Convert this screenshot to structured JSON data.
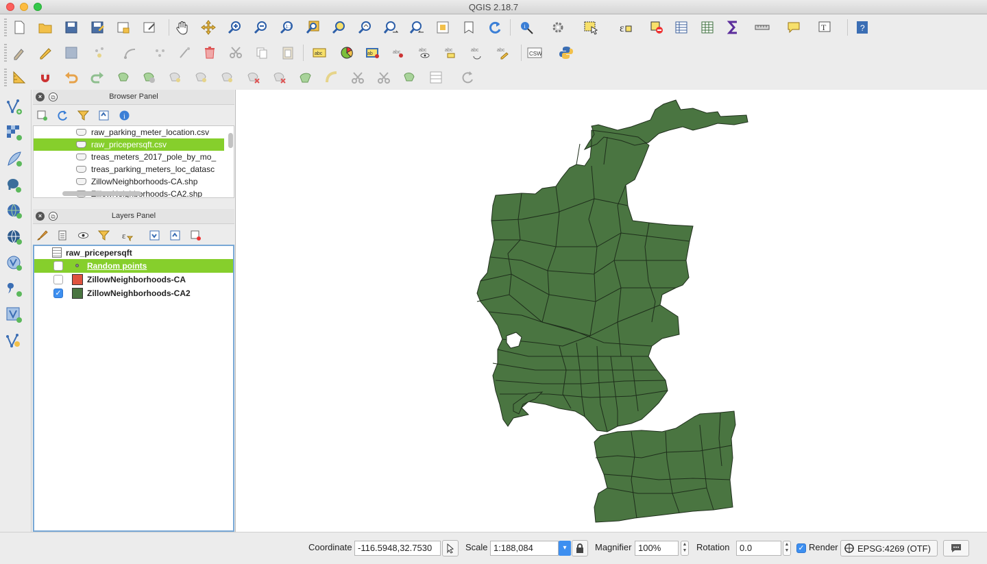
{
  "window": {
    "title": "QGIS 2.18.7"
  },
  "browser_panel": {
    "title": "Browser Panel",
    "items": [
      {
        "label": "raw_parking_meter_location.csv"
      },
      {
        "label": "raw_pricepersqft.csv",
        "selected": true
      },
      {
        "label": "treas_meters_2017_pole_by_mo_"
      },
      {
        "label": "treas_parking_meters_loc_datasc"
      },
      {
        "label": "ZillowNeighborhoods-CA.shp"
      },
      {
        "label": "ZillowNeighborhoods-CA2.shp"
      }
    ]
  },
  "layers_panel": {
    "title": "Layers Panel",
    "layers": [
      {
        "label": "raw_pricepersqft",
        "type": "table"
      },
      {
        "label": "Random points",
        "checked": false,
        "selected": true
      },
      {
        "label": "ZillowNeighborhoods-CA",
        "checked": false,
        "color": "#e0533f"
      },
      {
        "label": "ZillowNeighborhoods-CA2",
        "checked": true,
        "color": "#4a7541"
      }
    ]
  },
  "map": {
    "fill_color": "#4a7541",
    "stroke_color": "#1e2e1b"
  },
  "statusbar": {
    "coordinate_label": "Coordinate",
    "coordinate_value": "-116.5948,32.7530",
    "scale_label": "Scale",
    "scale_value": "1:188,084",
    "magnifier_label": "Magnifier",
    "magnifier_value": "100%",
    "rotation_label": "Rotation",
    "rotation_value": "0.0",
    "render_label": "Render",
    "render_checked": true,
    "crs_label": "EPSG:4269 (OTF)"
  }
}
